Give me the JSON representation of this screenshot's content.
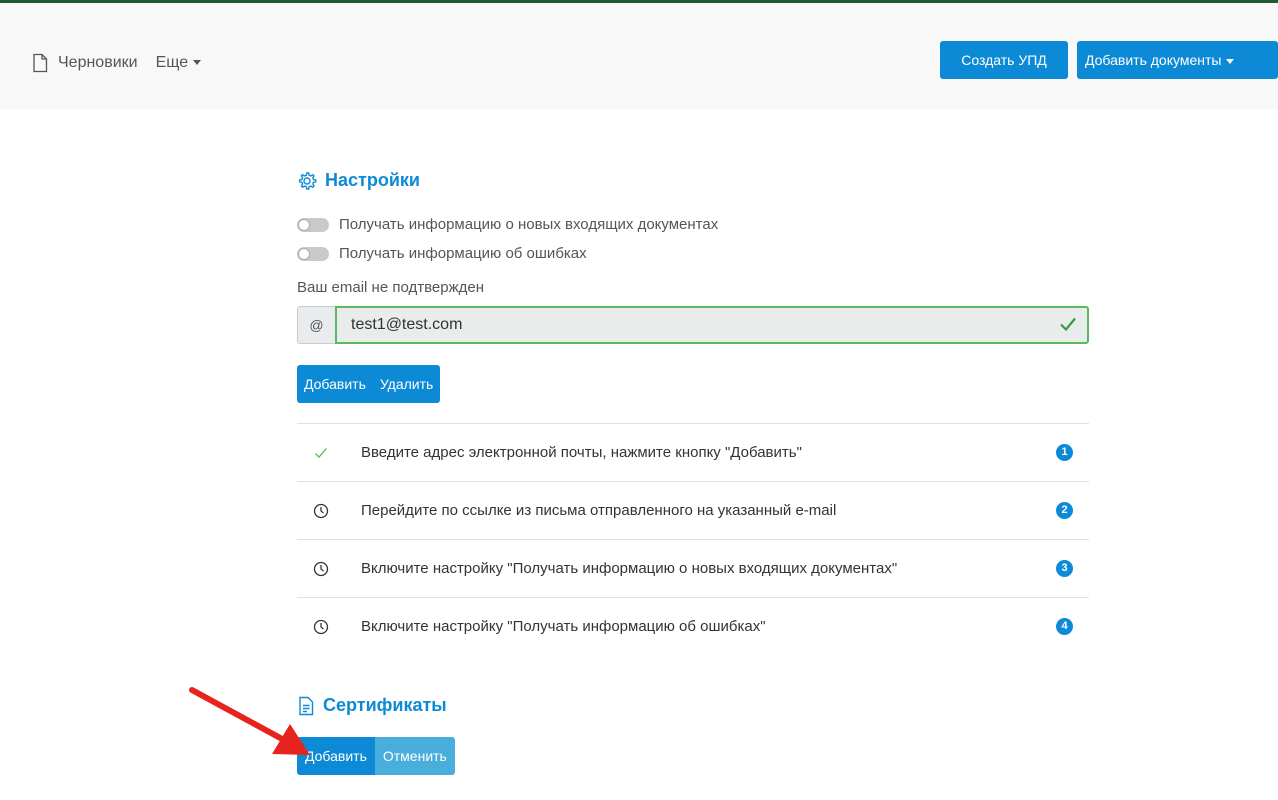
{
  "navbar": {
    "drafts_label": "Черновики",
    "more_label": "Еще",
    "create_upd_label": "Создать УПД",
    "add_documents_label": "Добавить документы"
  },
  "settings": {
    "title": "Настройки",
    "toggle_incoming": "Получать информацию о новых входящих документах",
    "toggle_errors": "Получать информацию об ошибках",
    "email_status": "Ваш email не подтвержден",
    "email_addon": "@",
    "email_value": "test1@test.com",
    "add_label": "Добавить",
    "delete_label": "Удалить",
    "steps": [
      {
        "text": "Введите адрес электронной почты, нажмите кнопку \"Добавить\"",
        "num": "1",
        "status": "done"
      },
      {
        "text": "Перейдите по ссылке из письма отправленного на указанный e-mail",
        "num": "2",
        "status": "pending"
      },
      {
        "text": "Включите настройку \"Получать информацию о новых входящих документах\"",
        "num": "3",
        "status": "pending"
      },
      {
        "text": "Включите настройку \"Получать информацию об ошибках\"",
        "num": "4",
        "status": "pending"
      }
    ]
  },
  "certificates": {
    "title": "Сертификаты",
    "add_label": "Добавить",
    "cancel_label": "Отменить"
  },
  "colors": {
    "primary": "#0d8ad6",
    "secondary": "#4aaedd",
    "success": "#5cb85c",
    "arrow": "#e8231d"
  },
  "icons": {
    "drafts": "document-icon",
    "settings": "gear-icon",
    "certificates": "file-text-icon",
    "step_done": "check-icon",
    "step_pending": "clock-icon"
  }
}
